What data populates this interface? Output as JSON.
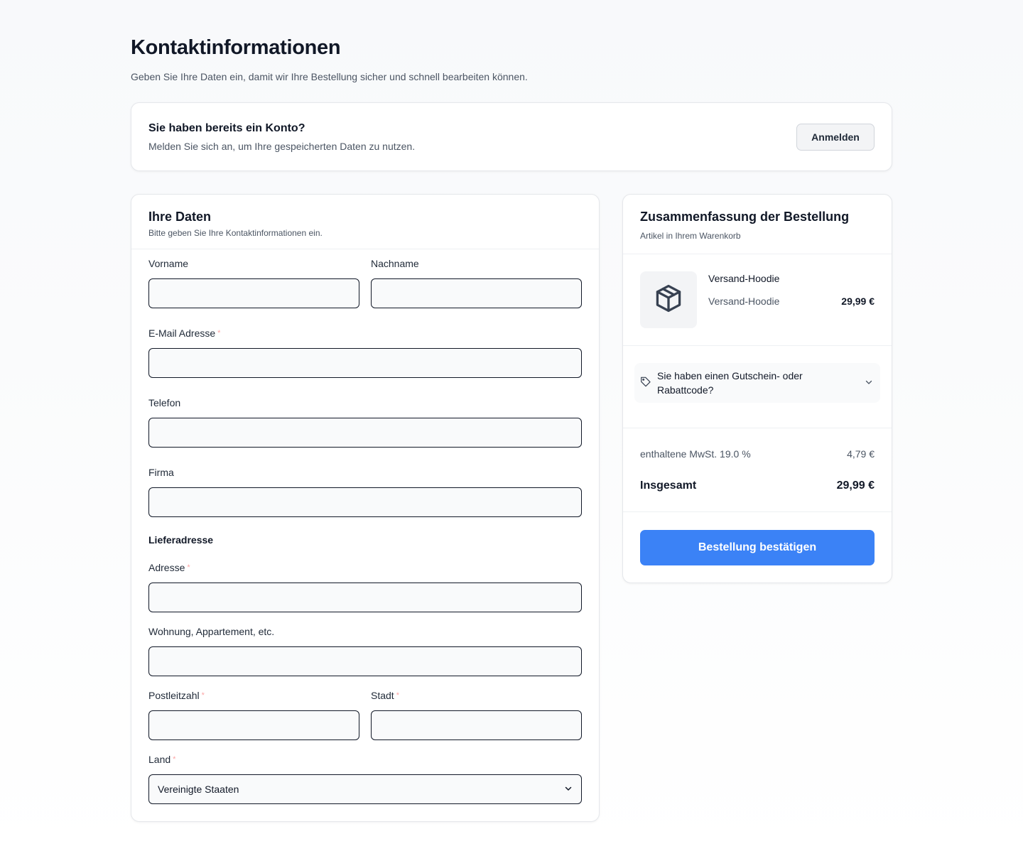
{
  "header": {
    "title": "Kontaktinformationen",
    "subtitle": "Geben Sie Ihre Daten ein, damit wir Ihre Bestellung sicher und schnell bearbeiten können."
  },
  "account": {
    "title": "Sie haben bereits ein Konto?",
    "description": "Melden Sie sich an, um Ihre gespeicherten Daten zu nutzen.",
    "login_label": "Anmelden"
  },
  "form": {
    "title": "Ihre Daten",
    "subtitle": "Bitte geben Sie Ihre Kontaktinformationen ein.",
    "first_name": {
      "label": "Vorname",
      "value": "",
      "required": false
    },
    "last_name": {
      "label": "Nachname",
      "value": "",
      "required": false
    },
    "email": {
      "label": "E-Mail Adresse",
      "value": "",
      "required": true
    },
    "phone": {
      "label": "Telefon",
      "value": "",
      "required": false
    },
    "company": {
      "label": "Firma",
      "value": "",
      "required": false
    },
    "shipping_section": "Lieferadresse",
    "address": {
      "label": "Adresse",
      "value": "",
      "required": true
    },
    "apartment": {
      "label": "Wohnung, Appartement, etc.",
      "value": "",
      "required": false
    },
    "postal_code": {
      "label": "Postleitzahl",
      "value": "",
      "required": true
    },
    "city": {
      "label": "Stadt",
      "value": "",
      "required": true
    },
    "country": {
      "label": "Land",
      "value": "Vereinigte Staaten",
      "required": true
    },
    "required_marker": "*"
  },
  "summary": {
    "title": "Zusammenfassung der Bestellung",
    "subtitle": "Artikel in Ihrem Warenkorb",
    "item": {
      "name": "Versand-Hoodie",
      "variant": "Versand-Hoodie",
      "price": "29,99 €",
      "icon": "package-icon"
    },
    "coupon_label": "Sie haben einen Gutschein- oder Rabattcode?",
    "tax_label": "enthaltene MwSt. 19.0 %",
    "tax_value": "4,79 €",
    "total_label": "Insgesamt",
    "total_value": "29,99 €",
    "confirm_label": "Bestellung bestätigen"
  },
  "colors": {
    "accent": "#3b82f6",
    "required": "#fca5a5",
    "text": "#111827",
    "muted": "#4b5563"
  }
}
